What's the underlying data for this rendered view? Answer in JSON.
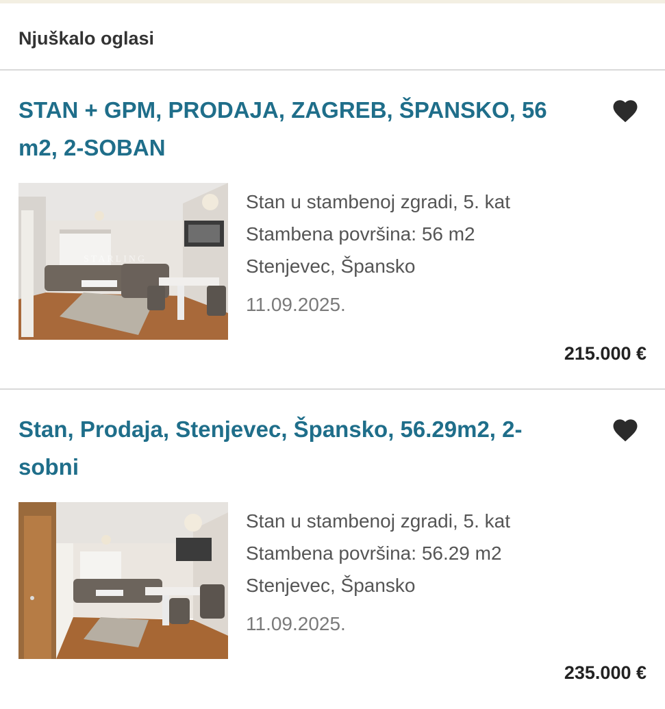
{
  "section": {
    "title": "Njuškalo oglasi"
  },
  "listings": [
    {
      "title": "STAN + GPM, PRODAJA, ZAGREB, ŠPANSKO, 56 m2, 2-SOBAN",
      "details": [
        "Stan u stambenoj zgradi, 5. kat",
        "Stambena površina: 56 m2",
        "Stenjevec, Špansko"
      ],
      "date": "11.09.2025.",
      "price": "215.000 €",
      "favorite_icon": "heart-icon",
      "watermark": "STARLING"
    },
    {
      "title": "Stan, Prodaja, Stenjevec, Špansko, 56.29m2, 2-sobni",
      "details": [
        "Stan u stambenoj zgradi, 5. kat",
        "Stambena površina: 56.29 m2",
        "Stenjevec, Špansko"
      ],
      "date": "11.09.2025.",
      "price": "235.000 €",
      "favorite_icon": "heart-icon"
    }
  ],
  "colors": {
    "title_link": "#1f6e8a",
    "price": "#222222",
    "detail_text": "#555555",
    "date_text": "#7a7a7a",
    "divider": "#d9d9d9"
  }
}
